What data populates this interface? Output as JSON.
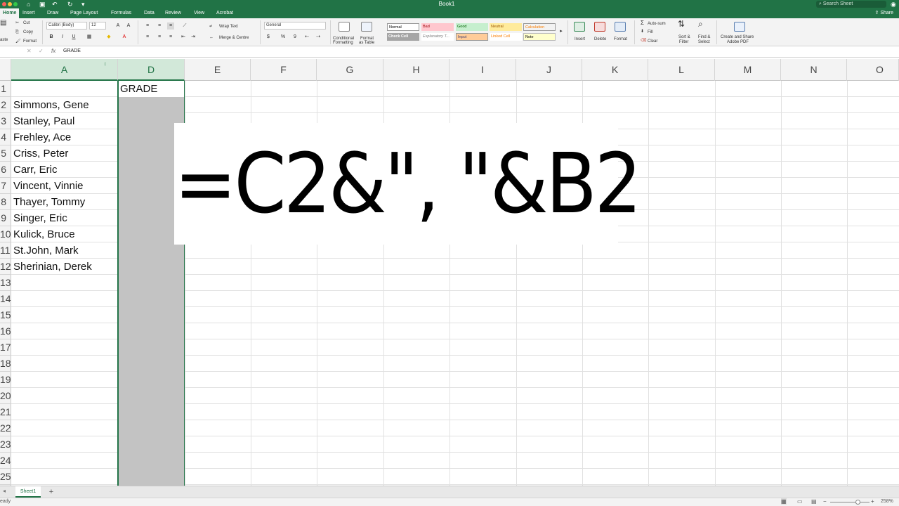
{
  "window": {
    "title": "Book1"
  },
  "titlebar": {
    "search_placeholder": "Search Sheet",
    "share_label": "Share"
  },
  "menu_tabs": [
    "Home",
    "Insert",
    "Draw",
    "Page Layout",
    "Formulas",
    "Data",
    "Review",
    "View",
    "Acrobat"
  ],
  "ribbon": {
    "paste_label": "aste",
    "cut_label": "Cut",
    "copy_label": "Copy",
    "format_painter_label": "Format",
    "font_name": "Calibri (Body)",
    "font_size": "12",
    "bold": "B",
    "italic": "I",
    "underline": "U",
    "wrap_text": "Wrap Text",
    "merge_center": "Merge & Centre",
    "number_format": "General",
    "currency": "$",
    "percent": "%",
    "comma": "9",
    "conditional_formatting": [
      "Conditional",
      "Formatting"
    ],
    "format_as_table": [
      "Format",
      "as Table"
    ],
    "styles": [
      {
        "label": "Normal",
        "bg": "#ffffff",
        "fg": "#000000"
      },
      {
        "label": "Bad",
        "bg": "#ffc7ce",
        "fg": "#9c0006"
      },
      {
        "label": "Good",
        "bg": "#c6efce",
        "fg": "#006100"
      },
      {
        "label": "Neutral",
        "bg": "#ffeb9c",
        "fg": "#9c5700"
      },
      {
        "label": "Calculation",
        "bg": "#f2f2f2",
        "fg": "#fa7d00"
      },
      {
        "label": "Check Cell",
        "bg": "#a5a5a5",
        "fg": "#ffffff"
      },
      {
        "label": "Explanatory T...",
        "bg": "#ffffff",
        "fg": "#7f7f7f"
      },
      {
        "label": "Input",
        "bg": "#ffcc99",
        "fg": "#3f3f76"
      },
      {
        "label": "Linked Cell",
        "bg": "#ffffff",
        "fg": "#fa7d00"
      },
      {
        "label": "Note",
        "bg": "#ffffcc",
        "fg": "#000000"
      }
    ],
    "insert": "Insert",
    "delete": "Delete",
    "format": "Format",
    "autosum": "Auto-sum",
    "fill": "Fill",
    "clear": "Clear",
    "sort_filter": [
      "Sort &",
      "Filter"
    ],
    "find_select": [
      "Find &",
      "Select"
    ],
    "create_share": [
      "Create and Share",
      "Adobe PDF"
    ]
  },
  "formula_bar": {
    "name_box": "",
    "fx": "fx",
    "content": "GRADE"
  },
  "columns": [
    {
      "letter": "A",
      "selected": true
    },
    {
      "letter": "D",
      "selected": true
    },
    {
      "letter": "E",
      "selected": false
    },
    {
      "letter": "F",
      "selected": false
    },
    {
      "letter": "G",
      "selected": false
    },
    {
      "letter": "H",
      "selected": false
    },
    {
      "letter": "I",
      "selected": false
    },
    {
      "letter": "J",
      "selected": false
    },
    {
      "letter": "K",
      "selected": false
    },
    {
      "letter": "L",
      "selected": false
    },
    {
      "letter": "M",
      "selected": false
    },
    {
      "letter": "N",
      "selected": false
    },
    {
      "letter": "O",
      "selected": false
    }
  ],
  "rows": [
    "1",
    "2",
    "3",
    "4",
    "5",
    "6",
    "7",
    "8",
    "9",
    "10",
    "11",
    "12",
    "13",
    "14",
    "15",
    "16",
    "17",
    "18",
    "19",
    "20",
    "21",
    "22",
    "23",
    "24",
    "25"
  ],
  "column_a": [
    "",
    "Simmons, Gene",
    "Stanley, Paul",
    "Frehley, Ace",
    "Criss, Peter",
    "Carr, Eric",
    "Vincent, Vinnie",
    "Thayer, Tommy",
    "Singer, Eric",
    "Kulick, Bruce",
    "St.John, Mark",
    "Sherinian, Derek"
  ],
  "column_d_header": "GRADE",
  "overlay_formula": "=C2&\", \"&B2",
  "sheets": [
    {
      "name": "Sheet1",
      "active": true
    }
  ],
  "add_sheet": "+",
  "status": {
    "mode": "eady",
    "zoom": "258%"
  },
  "colors": {
    "accent": "#217346",
    "selection_fill": "#c3c3c3"
  }
}
